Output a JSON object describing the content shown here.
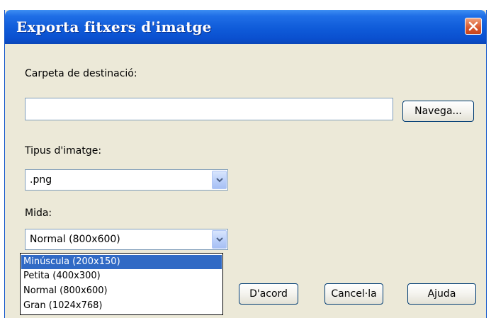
{
  "window": {
    "title": "Exporta fitxers d'imatge"
  },
  "destination": {
    "label": "Carpeta de destinació:",
    "value": "",
    "browse_label": "Navega..."
  },
  "image_type": {
    "label": "Tipus d'imatge:",
    "selected": ".png"
  },
  "size": {
    "label": "Mida:",
    "selected": "Normal (800x600)",
    "options": [
      "Minúscula (200x150)",
      "Petita (400x300)",
      "Normal (800x600)",
      "Gran (1024x768)"
    ],
    "highlighted_index": 0
  },
  "buttons": {
    "ok": "D'acord",
    "cancel": "Cancel·la",
    "help": "Ajuda"
  },
  "icons": {
    "close": "close-icon",
    "dropdown_arrow": "chevron-down-icon"
  },
  "colors": {
    "titlebar": "#0f5bd9",
    "close_button": "#d8572e",
    "selection": "#316ac5",
    "dialog_bg": "#ece9d8"
  }
}
